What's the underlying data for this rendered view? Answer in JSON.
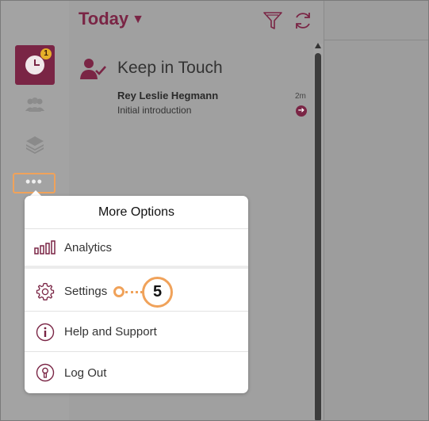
{
  "header": {
    "title": "Today",
    "caret": "▼"
  },
  "rail": {
    "badge_count": "1",
    "more_dots": "•••"
  },
  "section": {
    "title": "Keep in Touch"
  },
  "contact": {
    "name": "Rey Leslie Hegmann",
    "subtitle": "Initial introduction",
    "time": "2m",
    "go_glyph": "➔"
  },
  "popup": {
    "title": "More Options",
    "items": [
      {
        "label": "Analytics",
        "icon": "analytics-icon"
      },
      {
        "label": "Settings",
        "icon": "gear-icon"
      },
      {
        "label": "Help and Support",
        "icon": "info-icon"
      },
      {
        "label": "Log Out",
        "icon": "logout-icon"
      }
    ]
  },
  "callout": {
    "step": "5"
  },
  "colors": {
    "brand": "#7a2545",
    "callout": "#f0a25a",
    "badge": "#e5b029"
  }
}
